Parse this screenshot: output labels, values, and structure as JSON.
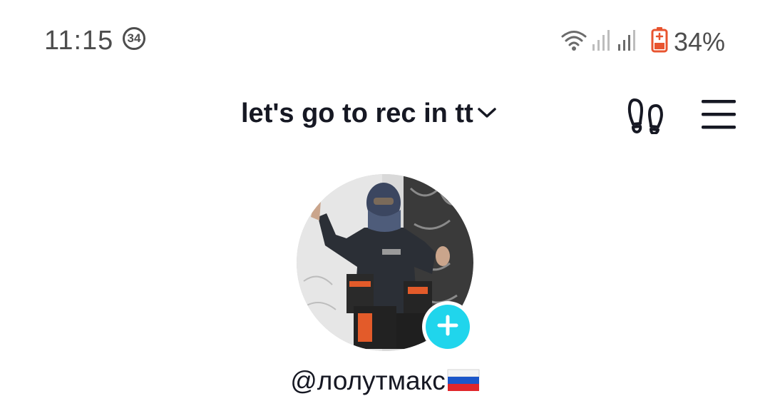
{
  "status_bar": {
    "time": "11:15",
    "notification_count": "34",
    "battery_percent": "34%",
    "icons": [
      "wifi-icon",
      "signal-icon",
      "signal-icon",
      "battery-icon"
    ]
  },
  "header": {
    "account_name": "let's go to rec in tt",
    "dropdown_icon": "chevron-down-icon",
    "footprint_icon": "footprint-icon",
    "menu_icon": "hamburger-menu-icon"
  },
  "profile": {
    "avatar_icon": "avatar",
    "add_button_icon": "plus-icon",
    "username": "@лолутмакс",
    "flag_icon": "russia-flag-icon"
  },
  "colors": {
    "accent": "#20d5ec",
    "text_primary": "#161823",
    "status_text": "#4d4d4d",
    "battery_alert": "#e8542f"
  }
}
